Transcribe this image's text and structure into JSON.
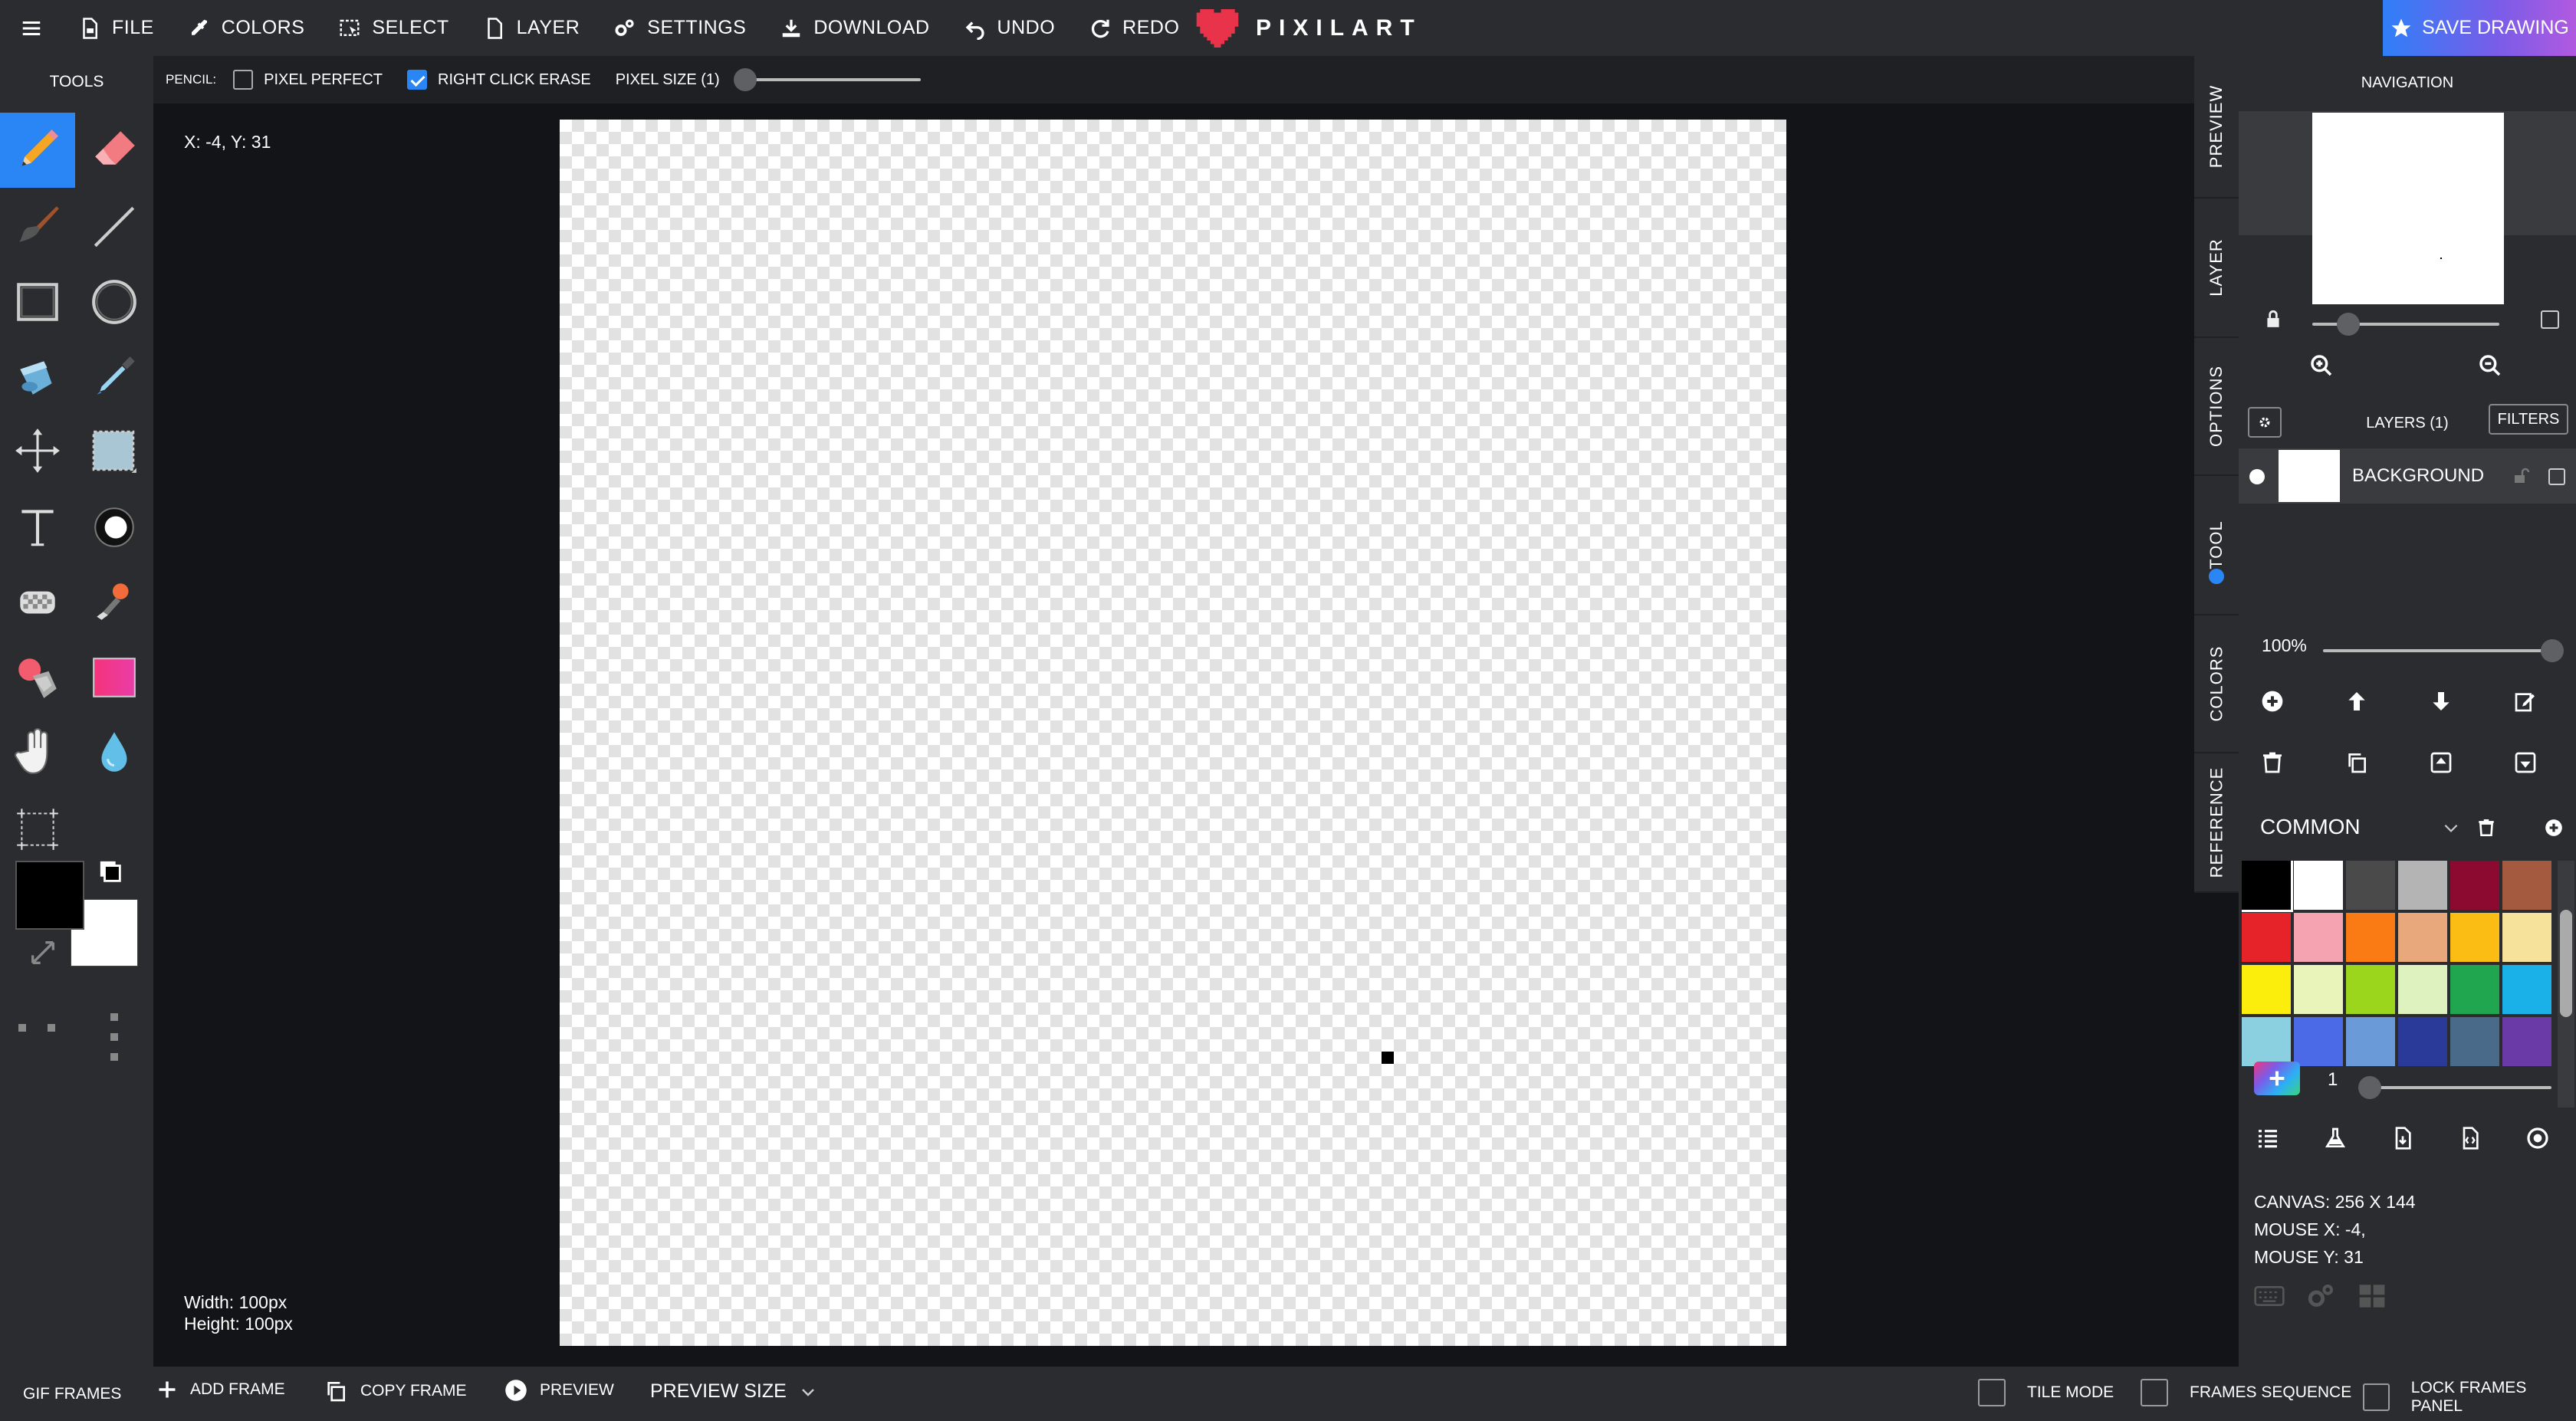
{
  "app": {
    "brand": "PIXILART"
  },
  "menu": {
    "file": "FILE",
    "colors": "COLORS",
    "select": "SELECT",
    "layer": "LAYER",
    "settings": "SETTINGS",
    "download": "DOWNLOAD",
    "undo": "UNDO",
    "redo": "REDO",
    "save_drawing": "SAVE DRAWING"
  },
  "options": {
    "tool_label": "PENCIL:",
    "pixel_perfect": "PIXEL PERFECT",
    "pixel_perfect_checked": false,
    "right_click_erase": "RIGHT CLICK ERASE",
    "right_click_erase_checked": true,
    "pixel_size": "PIXEL SIZE (1)",
    "pixel_size_value": 1
  },
  "tools": {
    "title": "TOOLS",
    "items": [
      "pencil-icon",
      "eraser-icon",
      "brush-icon",
      "line-icon",
      "rectangle-icon",
      "circle-icon",
      "bucket-icon",
      "eyedropper-icon",
      "move-icon",
      "select-icon",
      "text-icon",
      "lighten-icon",
      "dither-icon",
      "stamp-icon",
      "recolor-icon",
      "gradient-icon",
      "hand-icon",
      "blur-icon",
      "crop-icon"
    ],
    "primary_color": "#000000",
    "secondary_color": "#ffffff"
  },
  "canvas_info": {
    "coords": "X: -4, Y: 31",
    "width": "Width: 100px",
    "height": "Height: 100px"
  },
  "right_tabs": [
    "PREVIEW",
    "LAYER",
    "OPTIONS",
    "TOOL",
    "COLORS",
    "REFERENCE"
  ],
  "navigation": {
    "title": "NAVIGATION"
  },
  "layers": {
    "title": "LAYERS (1)",
    "filters": "FILTERS",
    "items": [
      {
        "name": "BACKGROUND"
      }
    ],
    "opacity": "100%",
    "opacity_value": 100
  },
  "palette": {
    "name": "COMMON",
    "colors": [
      "#000000",
      "#ffffff",
      "#4a4a4a",
      "#b4b4b4",
      "#8c0a2f",
      "#a35a3e",
      "#e52329",
      "#f5a3b1",
      "#fa7a14",
      "#e8a87c",
      "#fbbd14",
      "#f6e29a",
      "#fbee0c",
      "#e9f4ba",
      "#9bd61c",
      "#def2c0",
      "#21a650",
      "#1ab0e8",
      "#8bd0e0",
      "#4a6ae8",
      "#6a9ad8",
      "#2a3a98",
      "#4a6a8a",
      "#6a3aa6"
    ],
    "brush_size": "1",
    "brush_size_value": 1
  },
  "status": {
    "canvas": "CANVAS: 256 X 144",
    "mouse_x": "MOUSE X: -4,",
    "mouse_y": "MOUSE Y: 31"
  },
  "bottom": {
    "gif_frames": "GIF FRAMES",
    "add_frame": "ADD FRAME",
    "copy_frame": "COPY FRAME",
    "preview": "PREVIEW",
    "preview_size": "PREVIEW SIZE",
    "tile_mode": "TILE MODE",
    "frames_sequence": "FRAMES SEQUENCE",
    "lock_frames_panel": "LOCK FRAMES PANEL"
  }
}
